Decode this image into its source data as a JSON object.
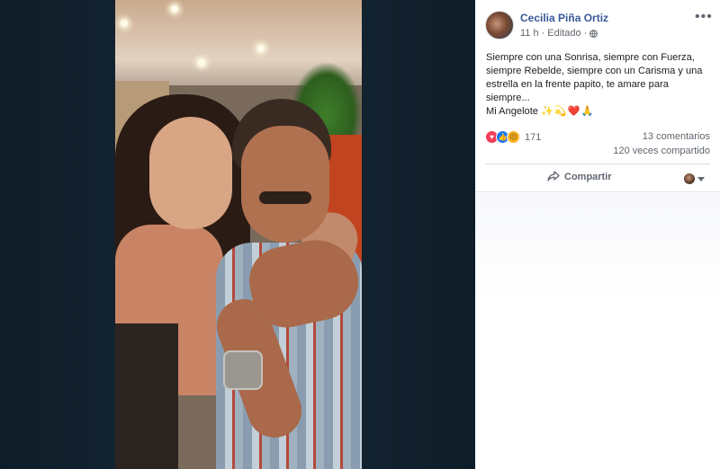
{
  "post": {
    "author": "Cecilia Piña Ortiz",
    "time": "11 h",
    "separator": "·",
    "edited": "Editado",
    "text_lines": [
      "Siempre con una Sonrisa, siempre con Fuerza,",
      "siempre Rebelde, siempre con un Carisma y una",
      "estrella en la frente papito, te amare para siempre...",
      "Mi Angelote"
    ],
    "text_emojis": "✨💫❤️🙏",
    "more_menu": "•••",
    "privacy_icon": "globe-icon",
    "avatar_icon": "profile-avatar"
  },
  "reactions": {
    "icons": [
      "love-reaction-icon",
      "like-reaction-icon",
      "sad-reaction-icon"
    ],
    "count": "171",
    "comments": "13 comentarios",
    "shares": "120 veces compartido"
  },
  "actions": {
    "share_label": "Compartir",
    "share_icon": "share-arrow-icon",
    "audience_icon": "mini-avatar-dropdown"
  },
  "colors": {
    "author_link": "#385898",
    "secondary_text": "#606770",
    "love": "#f33e58",
    "like": "#1877f2",
    "sad": "#f7b125",
    "viewer_background": "#14232f"
  }
}
